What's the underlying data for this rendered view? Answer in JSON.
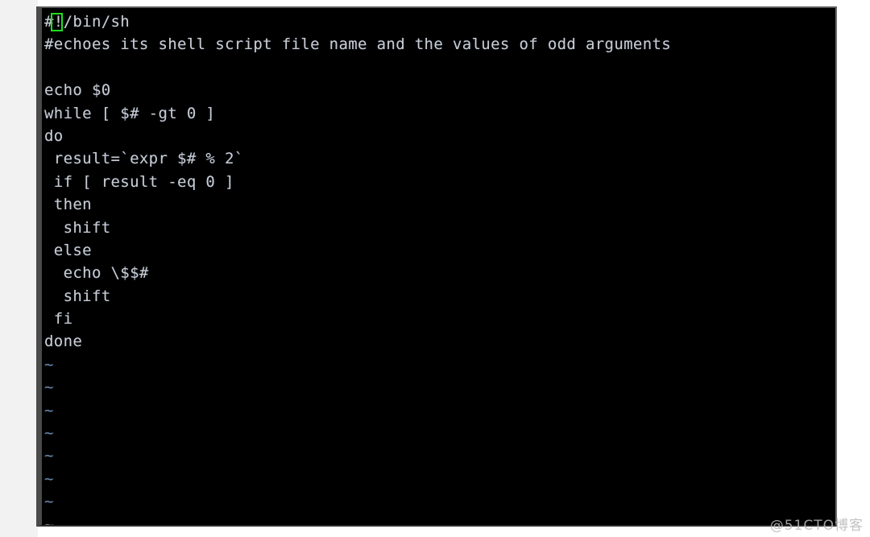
{
  "window": {
    "type": "terminal-emulator",
    "editor": "vi",
    "background_color": "#000000",
    "foreground_color": "#c8cdd4",
    "tilde_color": "#5b7fb0",
    "cursor_color": "#22dd22",
    "page_background": "#ffffff",
    "left_band_color": "#f2f2f2"
  },
  "cursor": {
    "shape": "block-outline",
    "line": 1,
    "column": 1,
    "char_under_cursor": "#"
  },
  "terminal": {
    "lines": [
      "#!/bin/sh",
      "#echoes its shell script file name and the values of odd arguments",
      "",
      "echo $0",
      "while [ $# -gt 0 ]",
      "do",
      " result=`expr $# % 2`",
      " if [ result -eq 0 ]",
      " then",
      "  shift",
      " else",
      "  echo \\$$#",
      "  shift",
      " fi",
      "done"
    ],
    "empty_line_markers": [
      "~",
      "~",
      "~",
      "~",
      "~",
      "~",
      "~",
      "~"
    ]
  },
  "watermark": {
    "text": "@51CTO博客"
  }
}
